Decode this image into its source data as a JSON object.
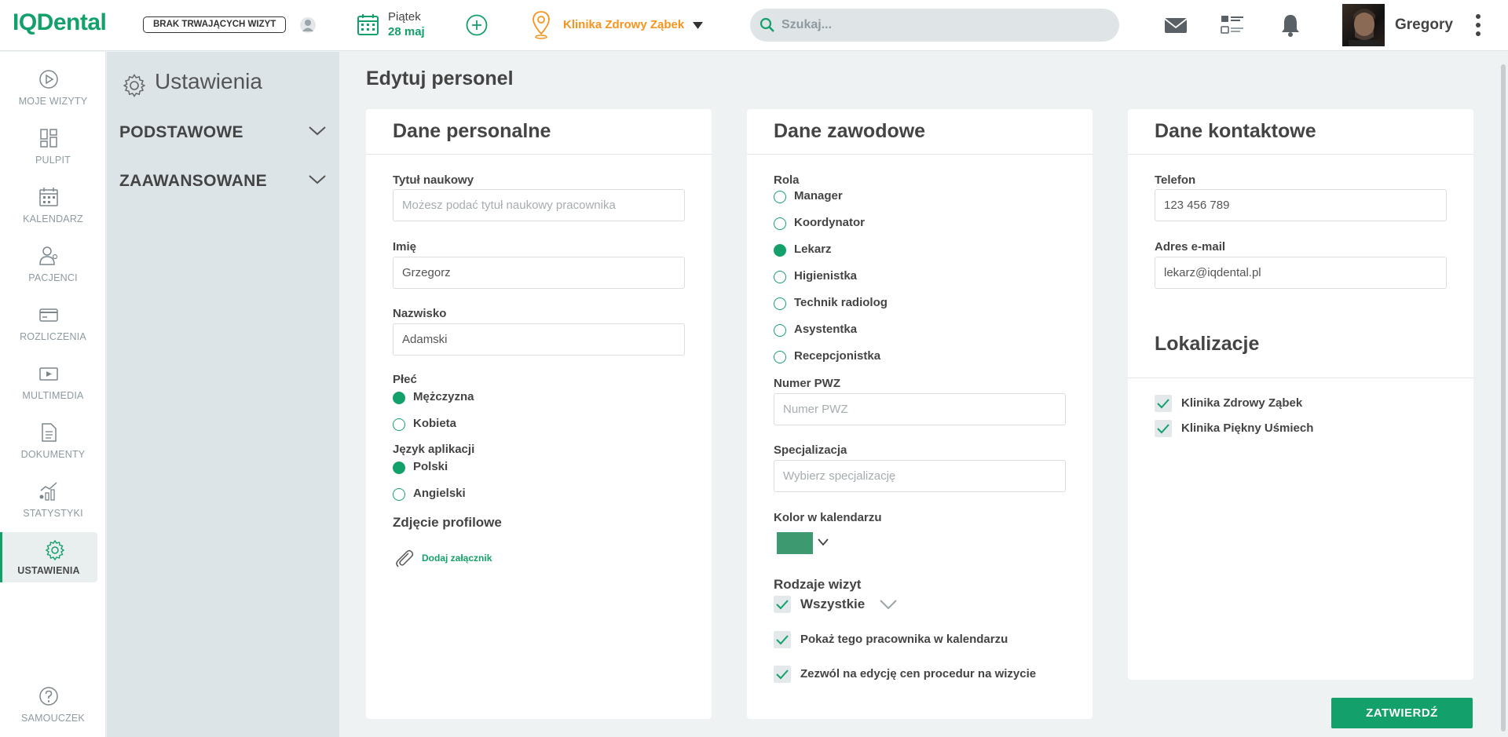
{
  "app": {
    "logo": "IQDental",
    "no_visit_badge": "BRAK TRWAJĄCYCH WIZYT"
  },
  "header": {
    "day": "Piątek",
    "date": "28 maj",
    "clinic": "Klinika Zdrowy Ząbek",
    "search_placeholder": "Szukaj...",
    "user_name": "Gregory"
  },
  "nav": {
    "items": [
      {
        "label": "MOJE WIZYTY",
        "icon": "play-circle-icon"
      },
      {
        "label": "PULPIT",
        "icon": "dashboard-icon"
      },
      {
        "label": "KALENDARZ",
        "icon": "calendar-icon"
      },
      {
        "label": "PACJENCI",
        "icon": "patients-icon"
      },
      {
        "label": "ROZLICZENIA",
        "icon": "card-icon"
      },
      {
        "label": "MULTIMEDIA",
        "icon": "multimedia-icon"
      },
      {
        "label": "DOKUMENTY",
        "icon": "document-icon"
      },
      {
        "label": "STATYSTYKI",
        "icon": "stats-icon"
      },
      {
        "label": "USTAWIENIA",
        "icon": "gear-icon",
        "active": true
      }
    ],
    "help_label": "SAMOUCZEK"
  },
  "settings": {
    "title": "Ustawienia",
    "sections": [
      "PODSTAWOWE",
      "ZAAWANSOWANE"
    ]
  },
  "page": {
    "title": "Edytuj personel",
    "submit_label": "ZATWIERDŹ"
  },
  "personal": {
    "title": "Dane personalne",
    "degree_label": "Tytuł naukowy",
    "degree_placeholder": "Możesz podać tytuł naukowy pracownika",
    "first_name_label": "Imię",
    "first_name": "Grzegorz",
    "last_name_label": "Nazwisko",
    "last_name": "Adamski",
    "gender_label": "Płeć",
    "gender_options": [
      "Mężczyzna",
      "Kobieta"
    ],
    "gender_selected": "Mężczyzna",
    "lang_label": "Język aplikacji",
    "lang_options": [
      "Polski",
      "Angielski"
    ],
    "lang_selected": "Polski",
    "photo_label": "Zdjęcie profilowe",
    "attach_label": "Dodaj załącznik"
  },
  "professional": {
    "title": "Dane zawodowe",
    "role_label": "Rola",
    "roles": [
      "Manager",
      "Koordynator",
      "Lekarz",
      "Higienistka",
      "Technik radiolog",
      "Asystentka",
      "Recepcjonistka"
    ],
    "role_selected": "Lekarz",
    "pwz_label": "Numer PWZ",
    "pwz_placeholder": "Numer PWZ",
    "spec_label": "Specjalizacja",
    "spec_placeholder": "Wybierz specjalizację",
    "color_label": "Kolor w kalendarzu",
    "color_value": "#3d9970",
    "visits_label": "Rodzaje wizyt",
    "visits_all": "Wszystkie",
    "show_in_calendar": "Pokaż tego pracownika w kalendarzu",
    "allow_price_edit": "Zezwól na edycję cen procedur na wizycie"
  },
  "contact": {
    "title": "Dane kontaktowe",
    "phone_label": "Telefon",
    "phone": "123 456 789",
    "email_label": "Adres e-mail",
    "email": "lekarz@iqdental.pl",
    "locations_title": "Lokalizacje",
    "locations": [
      "Klinika Zdrowy Ząbek",
      "Klinika Piękny Uśmiech"
    ]
  },
  "colors": {
    "accent": "#14a06a",
    "clinic": "#f7941d"
  }
}
